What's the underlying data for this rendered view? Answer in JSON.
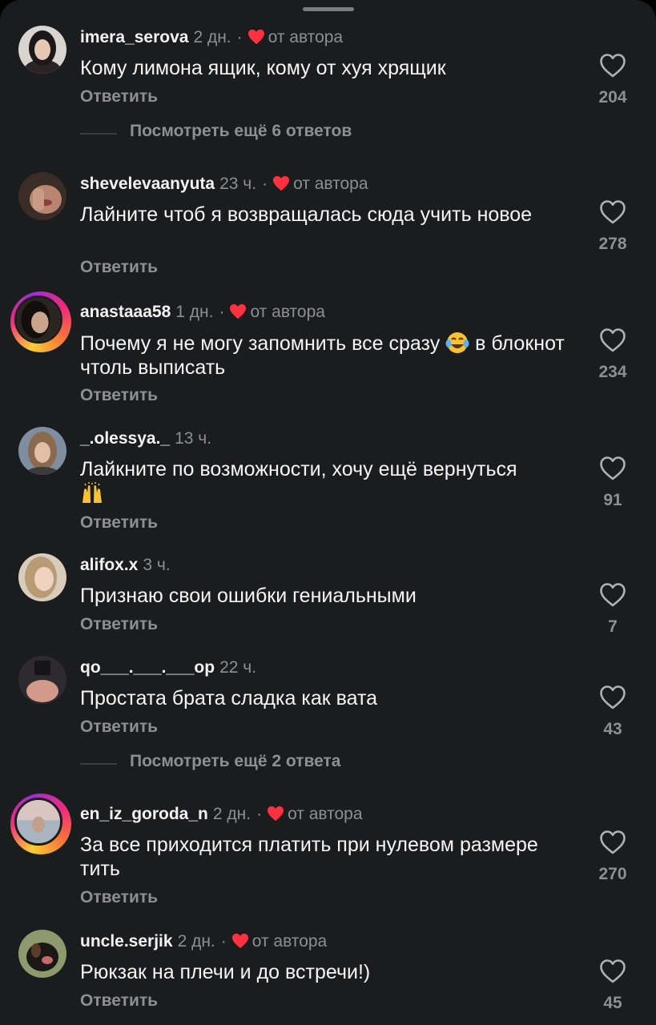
{
  "colors": {
    "background": "#1b1c1e",
    "text_primary": "#f5f5f6",
    "text_secondary": "#8e8f93",
    "heart_red": "#ff3040",
    "handle": "#7b7c80"
  },
  "labels": {
    "reply": "Ответить",
    "from_author": "от автора"
  },
  "comments": [
    {
      "username": "imera_serova",
      "time": "2 дн.",
      "author_liked": true,
      "text": "Кому лимона ящик, кому от хуя хрящик",
      "likes": "204",
      "avatar_icon": "avatar-photo"
    },
    {
      "username": "shevelevaanyuta",
      "time": "23 ч.",
      "author_liked": true,
      "text": "Лайните чтоб я возвращалась сюда учить новое",
      "likes": "278",
      "avatar_icon": "avatar-photo"
    },
    {
      "username": "anastaaa58",
      "time": "1 дн.",
      "author_liked": true,
      "text": "Почему я не могу запомнить все сразу",
      "text_after_emoji": "в блокнот чтоль выписать",
      "emoji": "tears-of-joy-emoji",
      "likes": "234",
      "avatar_icon": "avatar-photo-story-ring"
    },
    {
      "username": "_.olessya._",
      "time": "13 ч.",
      "author_liked": false,
      "text": "Лайкните по возможности, хочу ещё вернуться",
      "emoji": "raising-hands-emoji",
      "likes": "91",
      "avatar_icon": "avatar-photo"
    },
    {
      "username": "alifox.x",
      "time": "3 ч.",
      "author_liked": false,
      "text": "Признаю свои ошибки гениальными",
      "likes": "7",
      "avatar_icon": "avatar-photo"
    },
    {
      "username": "qo___.___.___op",
      "time": "22 ч.",
      "author_liked": false,
      "text": "Простата брата сладка как вата",
      "likes": "43",
      "avatar_icon": "avatar-photo"
    },
    {
      "username": "en_iz_goroda_n",
      "time": "2 дн.",
      "author_liked": true,
      "text": "За все приходится платить при нулевом размере тить",
      "likes": "270",
      "avatar_icon": "avatar-photo-story-ring"
    },
    {
      "username": "uncle.serjik",
      "time": "2 дн.",
      "author_liked": true,
      "text": "Рюкзак на плечи и до встречи!)",
      "likes": "45",
      "avatar_icon": "avatar-photo"
    }
  ],
  "more_replies": [
    {
      "label": "Посмотреть ещё 6 ответов"
    },
    {
      "label": "Посмотреть ещё 2 ответа"
    }
  ]
}
